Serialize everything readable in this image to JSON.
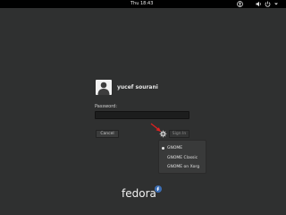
{
  "topbar": {
    "clock": "Thu 18:43",
    "tray_icons": [
      "accessibility-icon",
      "volume-icon",
      "power-icon",
      "chevron-down-icon"
    ]
  },
  "user": {
    "name": "yucef sourani"
  },
  "password": {
    "label": "Password:",
    "value": ""
  },
  "buttons": {
    "cancel": "Cancel",
    "sign_in": "Sign In"
  },
  "session_menu": {
    "items": [
      {
        "label": "GNOME",
        "selected": true
      },
      {
        "label": "GNOME Classic",
        "selected": false
      },
      {
        "label": "GNOME on Xorg",
        "selected": false
      }
    ]
  },
  "brand": {
    "name": "fedora"
  },
  "colors": {
    "background": "#2f3030",
    "topbar": "#000000",
    "arrow": "#e02020",
    "fedora_blue": "#3c6eb4"
  }
}
